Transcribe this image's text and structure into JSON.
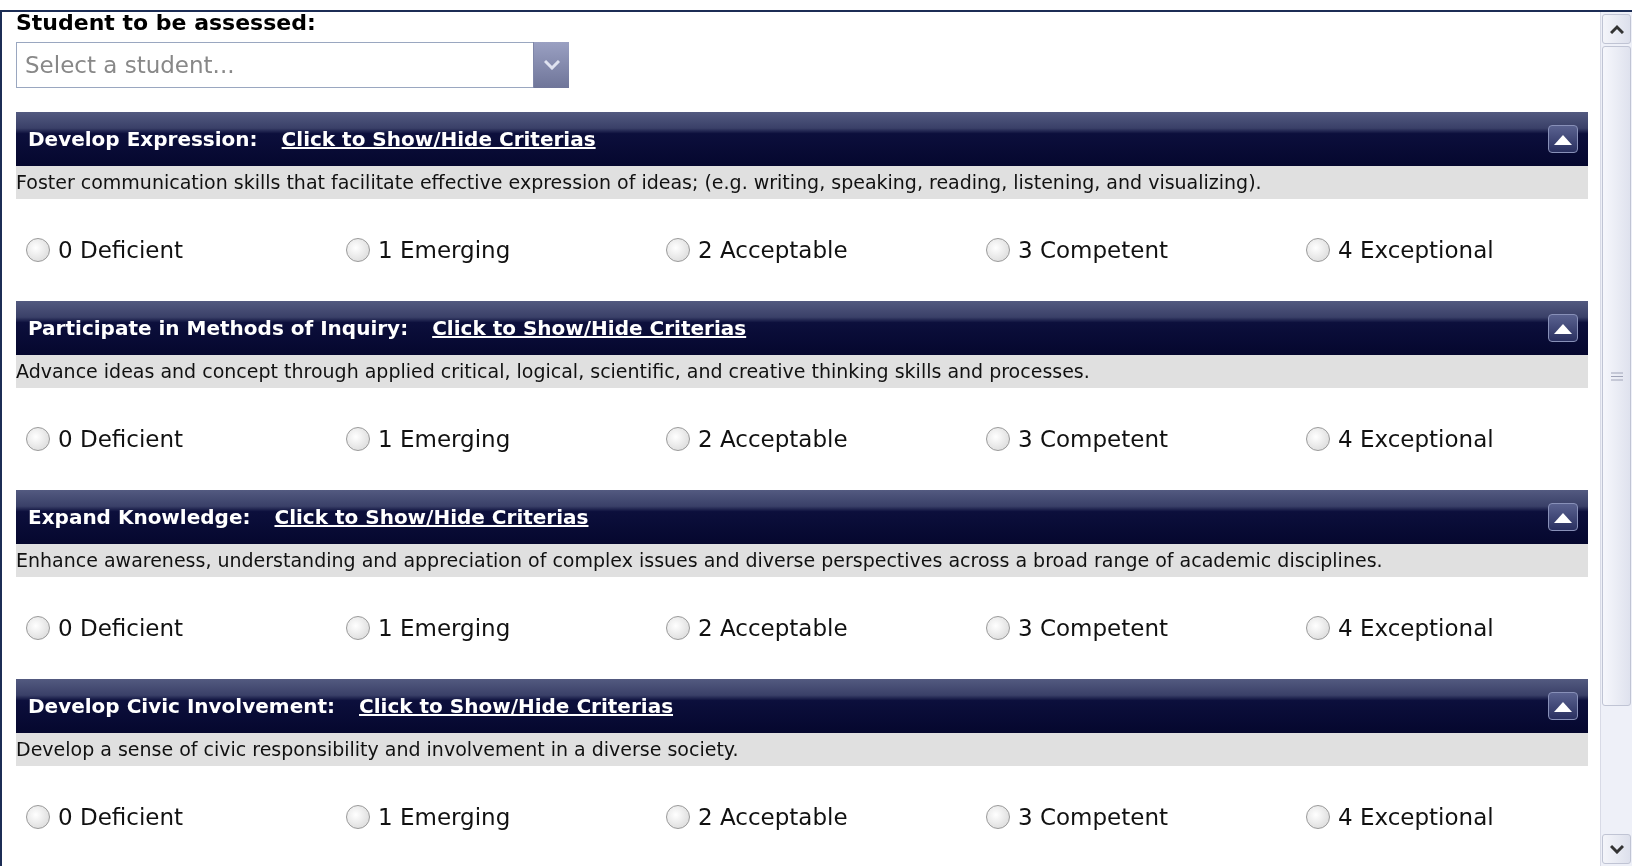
{
  "student_field": {
    "label": "Student to be assessed:",
    "placeholder": "Select a student..."
  },
  "sections": [
    {
      "title": "Develop Expression:",
      "toggle_link": "Click to Show/Hide Criterias",
      "description": "Foster communication skills that facilitate effective expression of ideas; (e.g. writing, speaking, reading, listening, and visualizing).",
      "options": [
        {
          "label": "0 Deficient",
          "selected": false
        },
        {
          "label": "1 Emerging",
          "selected": false
        },
        {
          "label": "2 Acceptable",
          "selected": false
        },
        {
          "label": "3 Competent",
          "selected": false
        },
        {
          "label": "4 Exceptional",
          "selected": false
        }
      ]
    },
    {
      "title": "Participate in Methods of Inquiry:",
      "toggle_link": "Click to Show/Hide Criterias",
      "description": "Advance ideas and concept through applied critical, logical, scientific, and creative thinking skills and processes.",
      "options": [
        {
          "label": "0 Deficient",
          "selected": false
        },
        {
          "label": "1 Emerging",
          "selected": false
        },
        {
          "label": "2 Acceptable",
          "selected": false
        },
        {
          "label": "3 Competent",
          "selected": false
        },
        {
          "label": "4 Exceptional",
          "selected": false
        }
      ]
    },
    {
      "title": "Expand Knowledge:",
      "toggle_link": "Click to Show/Hide Criterias",
      "description": "Enhance awareness, understanding and appreciation of complex issues and diverse perspectives across a broad range of academic disciplines.",
      "options": [
        {
          "label": "0 Deficient",
          "selected": false
        },
        {
          "label": "1 Emerging",
          "selected": false
        },
        {
          "label": "2 Acceptable",
          "selected": false
        },
        {
          "label": "3 Competent",
          "selected": false
        },
        {
          "label": "4 Exceptional",
          "selected": false
        }
      ]
    },
    {
      "title": "Develop Civic Involvement:",
      "toggle_link": "Click to Show/Hide Criterias",
      "description": "Develop a sense of civic responsibility and involvement in a diverse society.",
      "options": [
        {
          "label": "0 Deficient",
          "selected": false
        },
        {
          "label": "1 Emerging",
          "selected": false
        },
        {
          "label": "2 Acceptable",
          "selected": false
        },
        {
          "label": "3 Competent",
          "selected": false
        },
        {
          "label": "4 Exceptional",
          "selected": false
        }
      ]
    }
  ]
}
